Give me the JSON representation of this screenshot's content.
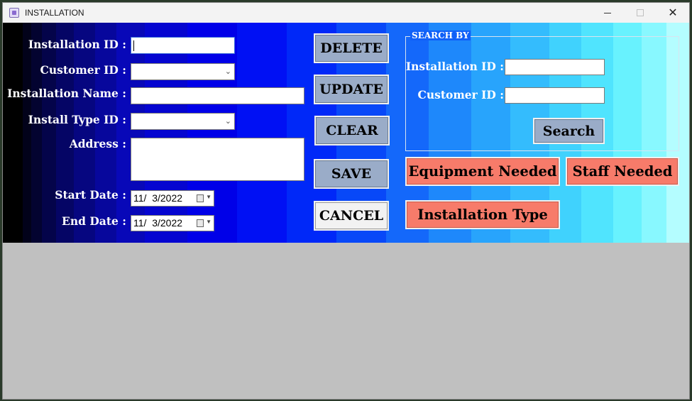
{
  "window": {
    "title": "INSTALLATION"
  },
  "form": {
    "installation_id_label": "Installation ID :",
    "installation_id_value": "",
    "customer_id_label": "Customer ID :",
    "customer_id_value": "",
    "installation_name_label": "Installation Name :",
    "installation_name_value": "",
    "install_type_id_label": "Install Type ID :",
    "install_type_id_value": "",
    "address_label": "Address :",
    "address_value": "",
    "start_date_label": "Start Date :",
    "start_date_value": "11/  3/2022",
    "end_date_label": "End Date :",
    "end_date_value": "11/  3/2022"
  },
  "actions": {
    "delete": "DELETE",
    "update": "UPDATE",
    "clear": "CLEAR",
    "save": "SAVE",
    "cancel": "CANCEL"
  },
  "search": {
    "group_title": "SEARCH BY",
    "installation_id_label": "Installation ID :",
    "installation_id_value": "",
    "customer_id_label": "Customer ID :",
    "customer_id_value": "",
    "search_button": "Search"
  },
  "navigation": {
    "equipment_needed": "Equipment Needed",
    "staff_needed": "Staff Needed",
    "installation_type": "Installation Type"
  },
  "colors": {
    "panel_dark": "#000000",
    "panel_blue": "#0000e8",
    "panel_light": "#b4fdff",
    "button_gray": "#9aacc8",
    "button_salmon": "#f77b6a",
    "background_gray": "#c0c0c0"
  }
}
